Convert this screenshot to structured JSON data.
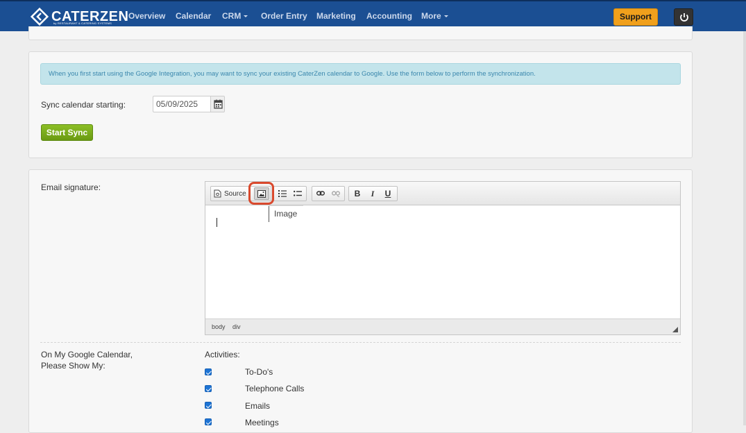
{
  "brand": {
    "name": "CATERZEN",
    "tagline": "by RESTAURANT & CATERING SYSTEMS"
  },
  "nav": {
    "items": [
      {
        "label": "Overview",
        "dropdown": false
      },
      {
        "label": "Calendar",
        "dropdown": false
      },
      {
        "label": "CRM",
        "dropdown": true
      },
      {
        "label": "Order Entry",
        "dropdown": false
      },
      {
        "label": "Marketing",
        "dropdown": false
      },
      {
        "label": "Accounting",
        "dropdown": false
      },
      {
        "label": "More",
        "dropdown": true
      }
    ],
    "support_label": "Support",
    "power_icon": "power-icon"
  },
  "sync": {
    "info": "When you first start using the Google Integration, you may want to sync your existing CaterZen calendar to Google. Use the form below to perform the synchronization.",
    "label": "Sync calendar starting:",
    "date_value": "05/09/2025",
    "calendar_icon": "calendar-icon",
    "button_label": "Start Sync"
  },
  "signature": {
    "label": "Email signature:",
    "toolbar": {
      "source_label": "Source",
      "icons": [
        "source-icon",
        "image-icon",
        "numbered-list-icon",
        "bulleted-list-icon",
        "link-icon",
        "unlink-icon",
        "bold-icon",
        "italic-icon",
        "underline-icon"
      ],
      "bold": "B",
      "italic": "I",
      "underline": "U"
    },
    "tooltip": "Image",
    "path": [
      "body",
      "div"
    ]
  },
  "google": {
    "label_line1": "On My Google Calendar,",
    "label_line2": "Please Show My:",
    "activities_label": "Activities:",
    "activities": [
      {
        "label": "To-Do's",
        "checked": true
      },
      {
        "label": "Telephone Calls",
        "checked": true
      },
      {
        "label": "Emails",
        "checked": true
      },
      {
        "label": "Meetings",
        "checked": true
      }
    ]
  },
  "colors": {
    "navbar": "#1b4f93",
    "support": "#f0a01c",
    "start_sync": "#7aab1b",
    "highlight": "#d9492d",
    "checkbox": "#1e74d4"
  }
}
